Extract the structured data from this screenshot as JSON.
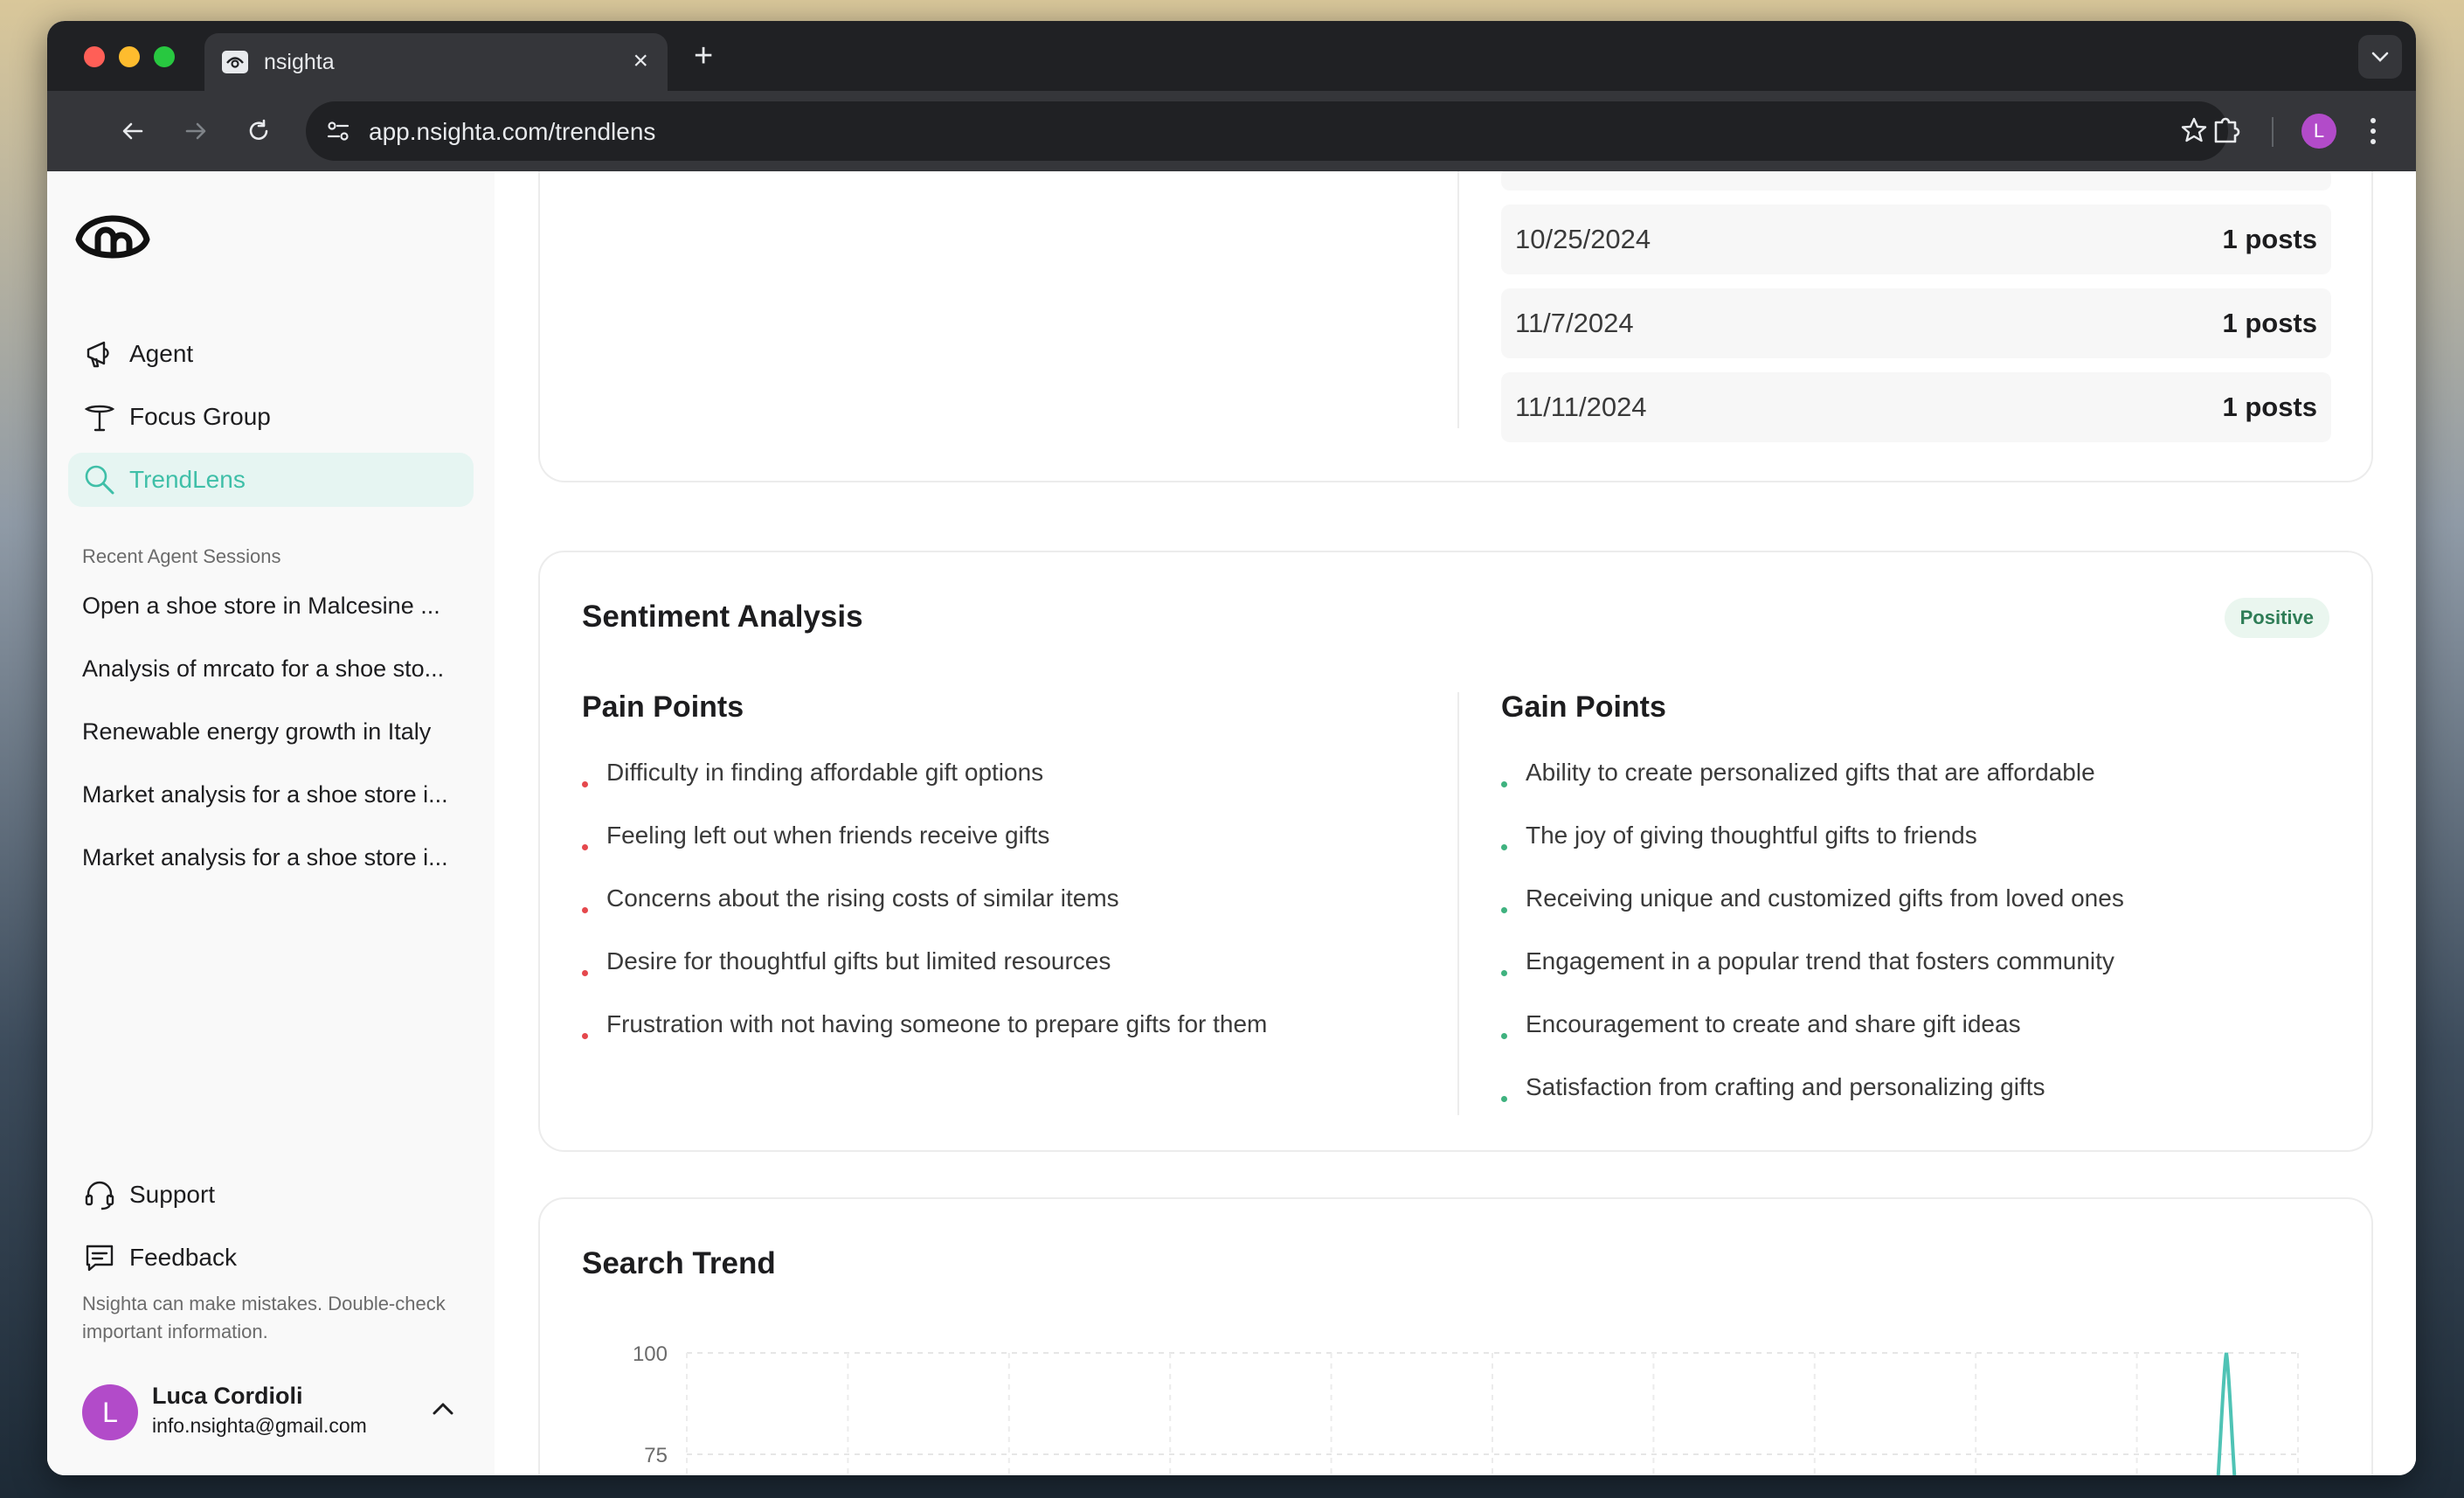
{
  "browser": {
    "tab_title": "nsighta",
    "url": "app.nsighta.com/trendlens",
    "profile_initial": "L"
  },
  "sidebar": {
    "nav": [
      {
        "label": "Agent",
        "icon": "megaphone-icon"
      },
      {
        "label": "Focus Group",
        "icon": "focus-group-icon"
      },
      {
        "label": "TrendLens",
        "icon": "search-icon",
        "active": true
      }
    ],
    "recent_label": "Recent Agent Sessions",
    "sessions": [
      "Open a shoe store in Malcesine ...",
      "Analysis of mrcato for a shoe sto...",
      "Renewable energy growth in Italy",
      "Market analysis for a shoe store i...",
      "Market analysis for a shoe store i..."
    ],
    "support_label": "Support",
    "feedback_label": "Feedback",
    "disclaimer": "Nsighta can make mistakes. Double-check important information.",
    "user": {
      "initial": "L",
      "name": "Luca Cordioli",
      "email": "info.nsighta@gmail.com"
    }
  },
  "posts_by_date": [
    {
      "date": "10/25/2024",
      "posts": "1 posts"
    },
    {
      "date": "11/7/2024",
      "posts": "1 posts"
    },
    {
      "date": "11/11/2024",
      "posts": "1 posts"
    }
  ],
  "sentiment": {
    "title": "Sentiment Analysis",
    "badge": "Positive",
    "pain_title": "Pain Points",
    "pain_points": [
      "Difficulty in finding affordable gift options",
      "Feeling left out when friends receive gifts",
      "Concerns about the rising costs of similar items",
      "Desire for thoughtful gifts but limited resources",
      "Frustration with not having someone to prepare gifts for them"
    ],
    "gain_title": "Gain Points",
    "gain_points": [
      "Ability to create personalized gifts that are affordable",
      "The joy of giving thoughtful gifts to friends",
      "Receiving unique and customized gifts from loved ones",
      "Engagement in a popular trend that fosters community",
      "Encouragement to create and share gift ideas",
      "Satisfaction from crafting and personalizing gifts"
    ],
    "colors": {
      "pain": "#e5484d",
      "gain": "#3fb27f"
    }
  },
  "search_trend": {
    "title": "Search Trend",
    "y_ticks": [
      "100",
      "75"
    ],
    "line_color": "#4fc3b5"
  },
  "chart_data": {
    "type": "line",
    "title": "Search Trend",
    "ylim": [
      0,
      100
    ],
    "y_ticks": [
      100,
      75
    ],
    "grid": true,
    "x_gridlines": 10,
    "note": "only upper portion visible",
    "peak_value": 100
  }
}
